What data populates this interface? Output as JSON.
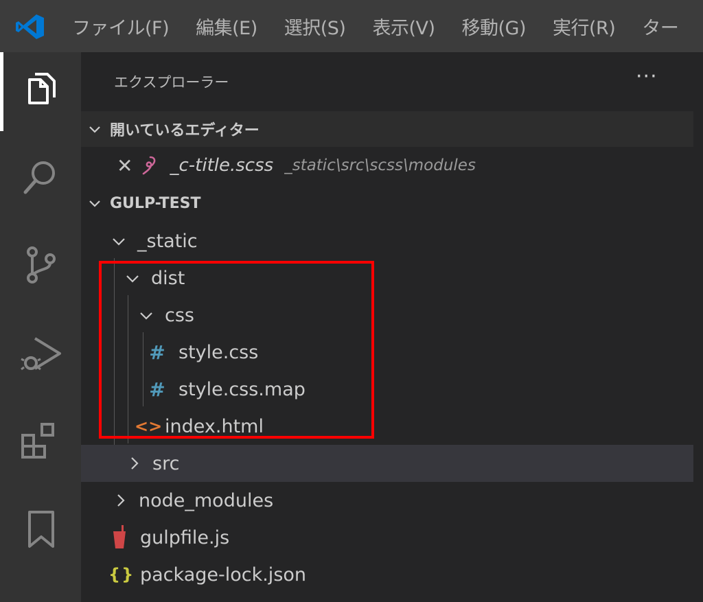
{
  "menubar": {
    "items": [
      "ファイル(F)",
      "編集(E)",
      "選択(S)",
      "表示(V)",
      "移動(G)",
      "実行(R)",
      "ター"
    ]
  },
  "activitybar": {
    "icons": [
      "explorer-icon",
      "search-icon",
      "source-control-icon",
      "run-debug-icon",
      "extensions-icon",
      "bookmark-icon"
    ]
  },
  "sidebar": {
    "title": "エクスプローラー",
    "more_label": "···",
    "open_editors": {
      "label": "開いているエディター",
      "items": [
        {
          "name": "_c-title.scss",
          "path": "_static\\src\\scss\\modules"
        }
      ]
    },
    "workspace": {
      "label": "GULP-TEST",
      "tree": [
        {
          "name": "_static",
          "type": "folder",
          "expanded": true
        },
        {
          "name": "dist",
          "type": "folder",
          "expanded": true
        },
        {
          "name": "css",
          "type": "folder",
          "expanded": true
        },
        {
          "name": "style.css",
          "type": "css"
        },
        {
          "name": "style.css.map",
          "type": "css"
        },
        {
          "name": "index.html",
          "type": "html"
        },
        {
          "name": "src",
          "type": "folder",
          "expanded": false
        },
        {
          "name": "node_modules",
          "type": "folder",
          "expanded": false
        },
        {
          "name": "gulpfile.js",
          "type": "gulp"
        },
        {
          "name": "package-lock.json",
          "type": "json"
        }
      ]
    }
  },
  "icons": {
    "css_glyph": "#",
    "html_glyph": "<>",
    "json_glyph": "{}"
  },
  "colors": {
    "highlight": "#ff0000",
    "vscode_blue": "#0078d4",
    "css_icon": "#519aba",
    "html_icon": "#e37933",
    "json_icon": "#cbcb41",
    "sass_icon": "#cd6799",
    "gulp_icon": "#cf4647"
  }
}
